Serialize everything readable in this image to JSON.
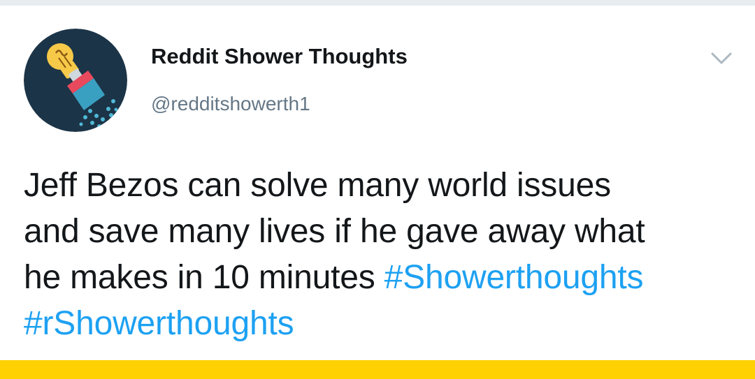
{
  "tweet": {
    "display_name": "Reddit Shower Thoughts",
    "handle": "@redditshowerth1",
    "text_line1": "Jeff Bezos can solve many world issues",
    "text_line2": "and save many lives if he gave away what",
    "text_line3_plain": "he makes in 10 minutes",
    "hashtags": [
      "#Showerthoughts",
      "#rShowerthoughts"
    ],
    "menu_icon": "chevron-down-icon",
    "avatar_icon": "lightbulb-showerhead-icon"
  },
  "colors": {
    "text": "#14171a",
    "secondary_text": "#657786",
    "hashtag": "#1da1f2",
    "avatar_background": "#1c3447",
    "bulb": "#f7c948",
    "showerhead": "#e8495c",
    "water": "#4fb9d6",
    "accent_bar": "#ffd100",
    "divider": "#e6ecf0"
  }
}
